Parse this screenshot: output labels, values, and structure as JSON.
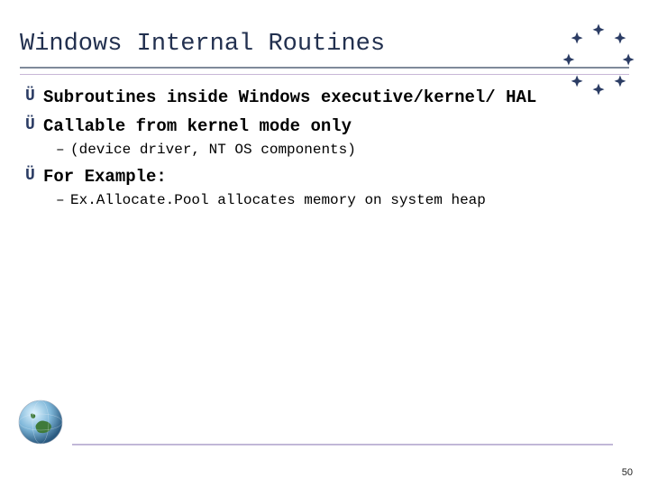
{
  "title": "Windows Internal Routines",
  "bullets": [
    {
      "level": 1,
      "text": "Subroutines inside Windows executive/kernel/ HAL"
    },
    {
      "level": 1,
      "text": "Callable from kernel mode only"
    },
    {
      "level": 2,
      "text": "(device driver, NT OS components)"
    },
    {
      "level": 1,
      "text": "For Example:"
    },
    {
      "level": 2,
      "text": "Ex.Allocate.Pool allocates memory on system heap"
    }
  ],
  "page_number": "50",
  "theme": {
    "title_color": "#22304f",
    "star_color": "#2b3c64",
    "arrow_glyph": "Ü",
    "dash_glyph": "–"
  }
}
